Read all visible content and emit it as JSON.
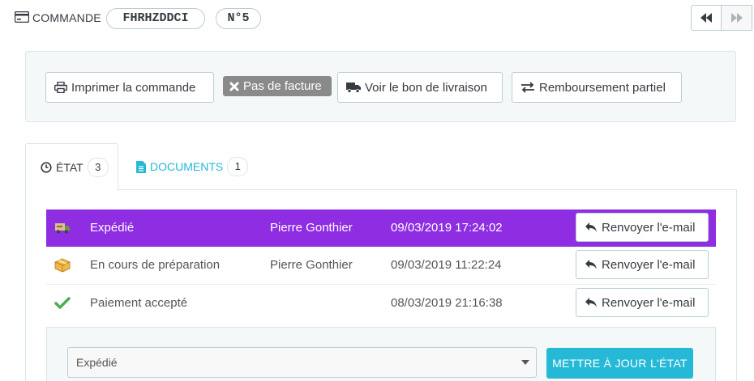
{
  "header": {
    "title": "COMMANDE",
    "reference": "FHRHZDDCI",
    "order_number": "N°5",
    "icons": {
      "order": "credit-card-icon",
      "prev": "backward-icon",
      "next": "forward-icon"
    }
  },
  "actions": {
    "print": "Imprimer la commande",
    "no_invoice": "Pas de facture",
    "delivery_slip": "Voir le bon de livraison",
    "partial_refund": "Remboursement partiel"
  },
  "tabs": [
    {
      "label": "ÉTAT",
      "count": "3",
      "icon": "clock-icon"
    },
    {
      "label": "DOCUMENTS",
      "count": "1",
      "icon": "document-icon"
    }
  ],
  "history": [
    {
      "status": "Expédié",
      "employee": "Pierre Gonthier",
      "date": "09/03/2019 17:24:02",
      "action": "Renvoyer l'e-mail",
      "icon": "truck-icon",
      "color": "#8e2de2"
    },
    {
      "status": "En cours de préparation",
      "employee": "Pierre Gonthier",
      "date": "09/03/2019 11:22:24",
      "action": "Renvoyer l'e-mail",
      "icon": "package-icon"
    },
    {
      "status": "Paiement accepté",
      "employee": "",
      "date": "08/03/2019 21:16:38",
      "action": "Renvoyer l'e-mail",
      "icon": "checkmark-icon"
    }
  ],
  "update": {
    "selected": "Expédié",
    "button": "METTRE À JOUR L'ÉTAT"
  },
  "colors": {
    "accent": "#25b9d7",
    "shipped": "#8e2de2"
  }
}
